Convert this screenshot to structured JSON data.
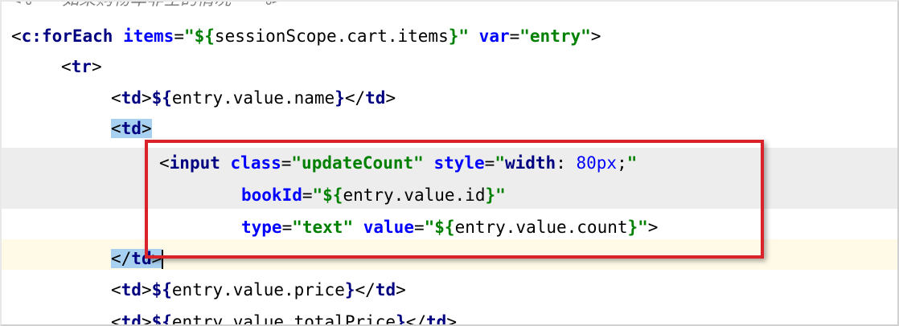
{
  "editor": {
    "lines": [
      {
        "tokens": [
          {
            "t": "comment",
            "v": "<%-- 如果购物车非空的情况 --%>"
          }
        ]
      },
      {
        "tokens": [
          {
            "t": "punct",
            "v": "<"
          },
          {
            "t": "tag",
            "v": "c:forEach"
          },
          {
            "t": "punct",
            "v": " "
          },
          {
            "t": "attr",
            "v": "items"
          },
          {
            "t": "punct",
            "v": "="
          },
          {
            "t": "str",
            "v": "\"${"
          },
          {
            "t": "el",
            "v": "sessionScope.cart.items"
          },
          {
            "t": "str",
            "v": "}\""
          },
          {
            "t": "punct",
            "v": " "
          },
          {
            "t": "attr",
            "v": "var"
          },
          {
            "t": "punct",
            "v": "="
          },
          {
            "t": "str",
            "v": "\"entry\""
          },
          {
            "t": "punct",
            "v": ">"
          }
        ]
      },
      {
        "tokens": [
          {
            "t": "punct",
            "v": "<"
          },
          {
            "t": "tag",
            "v": "tr"
          },
          {
            "t": "punct",
            "v": ">"
          }
        ]
      },
      {
        "tokens": [
          {
            "t": "punct",
            "v": "<"
          },
          {
            "t": "tag",
            "v": "td"
          },
          {
            "t": "punct",
            "v": ">"
          },
          {
            "t": "tag",
            "v": "${"
          },
          {
            "t": "el",
            "v": "entry.value.name"
          },
          {
            "t": "tag",
            "v": "}"
          },
          {
            "t": "punct",
            "v": "</"
          },
          {
            "t": "tag",
            "v": "td"
          },
          {
            "t": "punct",
            "v": ">"
          }
        ]
      },
      {
        "tokens": [
          {
            "t": "punct",
            "v": "<",
            "hl": true
          },
          {
            "t": "tag",
            "v": "td",
            "hl": true
          },
          {
            "t": "punct",
            "v": ">",
            "hl": true
          }
        ]
      },
      {
        "tokens": [
          {
            "t": "punct",
            "v": "<"
          },
          {
            "t": "tag",
            "v": "input"
          },
          {
            "t": "punct",
            "v": " "
          },
          {
            "t": "attr",
            "v": "class"
          },
          {
            "t": "punct",
            "v": "="
          },
          {
            "t": "str",
            "v": "\"updateCount\""
          },
          {
            "t": "punct",
            "v": " "
          },
          {
            "t": "attr",
            "v": "style"
          },
          {
            "t": "punct",
            "v": "="
          },
          {
            "t": "str",
            "v": "\""
          },
          {
            "t": "cssprop",
            "v": "width"
          },
          {
            "t": "punct",
            "v": ": "
          },
          {
            "t": "num",
            "v": "80px"
          },
          {
            "t": "punct",
            "v": ";"
          },
          {
            "t": "str",
            "v": "\""
          }
        ]
      },
      {
        "tokens": [
          {
            "t": "attr",
            "v": "bookId"
          },
          {
            "t": "punct",
            "v": "="
          },
          {
            "t": "str",
            "v": "\"${"
          },
          {
            "t": "el",
            "v": "entry.value.id"
          },
          {
            "t": "str",
            "v": "}\""
          }
        ]
      },
      {
        "tokens": [
          {
            "t": "attr",
            "v": "type"
          },
          {
            "t": "punct",
            "v": "="
          },
          {
            "t": "str",
            "v": "\"text\""
          },
          {
            "t": "punct",
            "v": " "
          },
          {
            "t": "attr",
            "v": "value"
          },
          {
            "t": "punct",
            "v": "="
          },
          {
            "t": "str",
            "v": "\"${"
          },
          {
            "t": "el",
            "v": "entry.value.count"
          },
          {
            "t": "str",
            "v": "}\""
          },
          {
            "t": "punct",
            "v": ">"
          }
        ]
      },
      {
        "tokens": [
          {
            "t": "punct",
            "v": "</",
            "hl": true
          },
          {
            "t": "tag",
            "v": "td",
            "hl": true
          },
          {
            "t": "punct",
            "v": ">",
            "hl": true
          }
        ],
        "caret": true
      },
      {
        "tokens": [
          {
            "t": "punct",
            "v": "<"
          },
          {
            "t": "tag",
            "v": "td"
          },
          {
            "t": "punct",
            "v": ">"
          },
          {
            "t": "tag",
            "v": "${"
          },
          {
            "t": "el",
            "v": "entry.value.price"
          },
          {
            "t": "tag",
            "v": "}"
          },
          {
            "t": "punct",
            "v": "</"
          },
          {
            "t": "tag",
            "v": "td"
          },
          {
            "t": "punct",
            "v": ">"
          }
        ]
      },
      {
        "tokens": [
          {
            "t": "punct",
            "v": "<"
          },
          {
            "t": "tag",
            "v": "td"
          },
          {
            "t": "punct",
            "v": ">"
          },
          {
            "t": "tag",
            "v": "${"
          },
          {
            "t": "el",
            "v": "entry.value.totalPrice"
          },
          {
            "t": "tag",
            "v": "}"
          },
          {
            "t": "punct",
            "v": "</"
          },
          {
            "t": "tag",
            "v": "td"
          },
          {
            "t": "punct",
            "v": ">"
          }
        ]
      }
    ]
  },
  "colors": {
    "highlight_box": "#d9222a",
    "tag_match_highlight": "#a8d0f0",
    "current_line": "#fffae8",
    "selection_gray": "#ededed"
  }
}
